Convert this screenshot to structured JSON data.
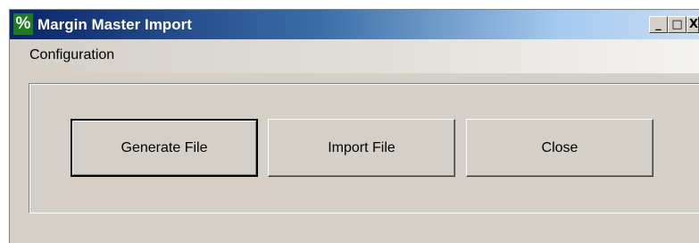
{
  "window": {
    "title": "Margin Master Import",
    "icon": "percent-icon",
    "icon_glyph": "%",
    "controls": {
      "minimize_glyph": "_",
      "maximize_glyph": "□",
      "close_glyph": "X"
    }
  },
  "menubar": {
    "items": [
      {
        "label": "Configuration"
      }
    ]
  },
  "actions": {
    "generate_label": "Generate File",
    "import_label": "Import File",
    "close_label": "Close"
  },
  "colors": {
    "titlebar_start": "#0a246a",
    "titlebar_end": "#c8dcf2",
    "face": "#d4d0c8",
    "icon_bg": "#1e7a1e"
  }
}
